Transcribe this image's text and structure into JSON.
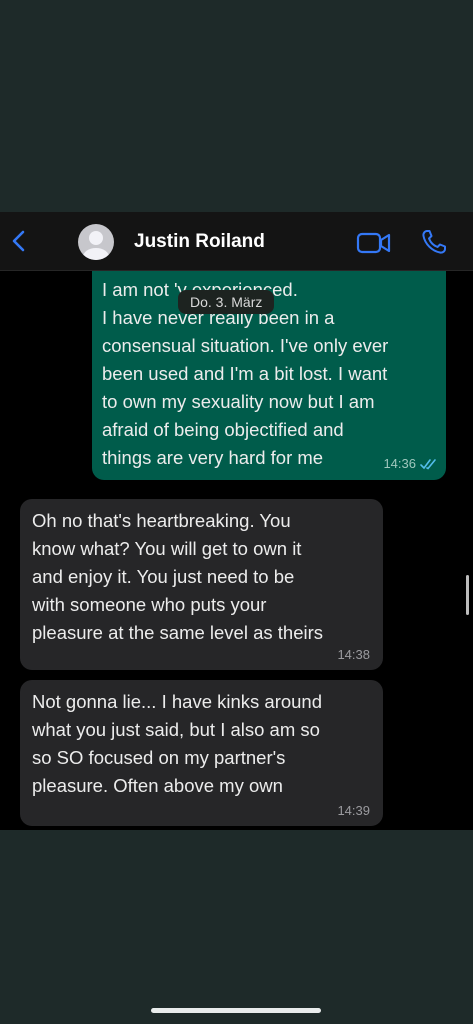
{
  "header": {
    "contact_name": "Justin Roiland",
    "icons": {
      "back": "chevron-left-icon",
      "avatar": "person-icon",
      "video": "video-camera-icon",
      "call": "phone-icon"
    },
    "accent_color": "#3478f6"
  },
  "date_separator": "Do. 3. März",
  "messages": [
    {
      "direction": "outgoing",
      "text": "I am not        'y experienced.\nI have never really been in a\nconsensual situation. I've only ever\nbeen used and I'm a bit lost. I want\nto own my sexuality now but I am\nafraid of being objectified and\nthings are very hard for me",
      "time": "14:36",
      "status": "read",
      "bubble_color": "#005c4b"
    },
    {
      "direction": "incoming",
      "text": "Oh no that's heartbreaking. You\nknow what? You will get to own it\nand enjoy it. You just need to be\nwith someone who puts your\npleasure at the same level as theirs",
      "time": "14:38",
      "bubble_color": "#262628"
    },
    {
      "direction": "incoming",
      "text": "Not gonna lie... I have kinks around\nwhat you just said, but I also am so\nso SO focused on my partner's\npleasure. Often above my own",
      "time": "14:39",
      "bubble_color": "#262628"
    }
  ]
}
